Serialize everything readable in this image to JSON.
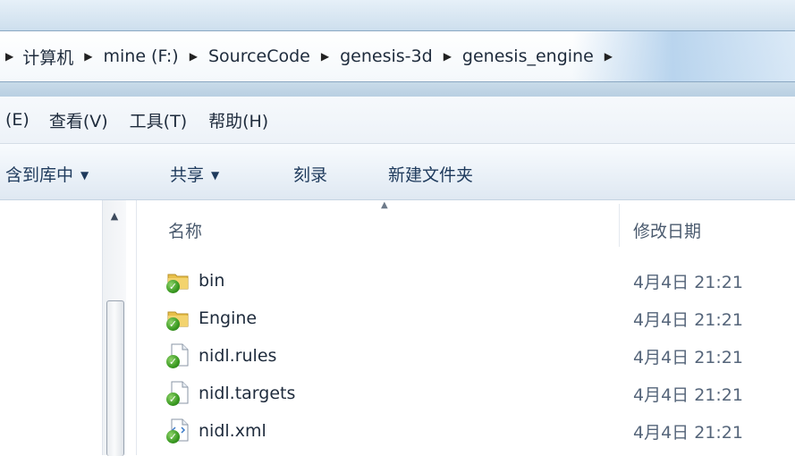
{
  "address_bar": {
    "crumbs": [
      "计算机",
      "mine (F:)",
      "SourceCode",
      "genesis-3d",
      "genesis_engine"
    ]
  },
  "menu": {
    "items": [
      "(E)",
      "查看(V)",
      "工具(T)",
      "帮助(H)"
    ]
  },
  "toolbar": {
    "include_in_library": "含到库中",
    "share": "共享",
    "burn": "刻录",
    "new_folder": "新建文件夹"
  },
  "columns": {
    "name": "名称",
    "date_modified": "修改日期"
  },
  "files": [
    {
      "name": "bin",
      "date": "4月4日 21:21",
      "icon": "folder-icon"
    },
    {
      "name": "Engine",
      "date": "4月4日 21:21",
      "icon": "folder-icon"
    },
    {
      "name": "nidl.rules",
      "date": "4月4日 21:21",
      "icon": "file-icon"
    },
    {
      "name": "nidl.targets",
      "date": "4月4日 21:21",
      "icon": "file-icon"
    },
    {
      "name": "nidl.xml",
      "date": "4月4日 21:21",
      "icon": "xml-file-icon"
    }
  ],
  "colors": {
    "sync_badge": "#3a9a22",
    "folder": "#e8c04a",
    "address_bar_bg": "#ffffff",
    "menu_bg": "#f3f6fa"
  }
}
